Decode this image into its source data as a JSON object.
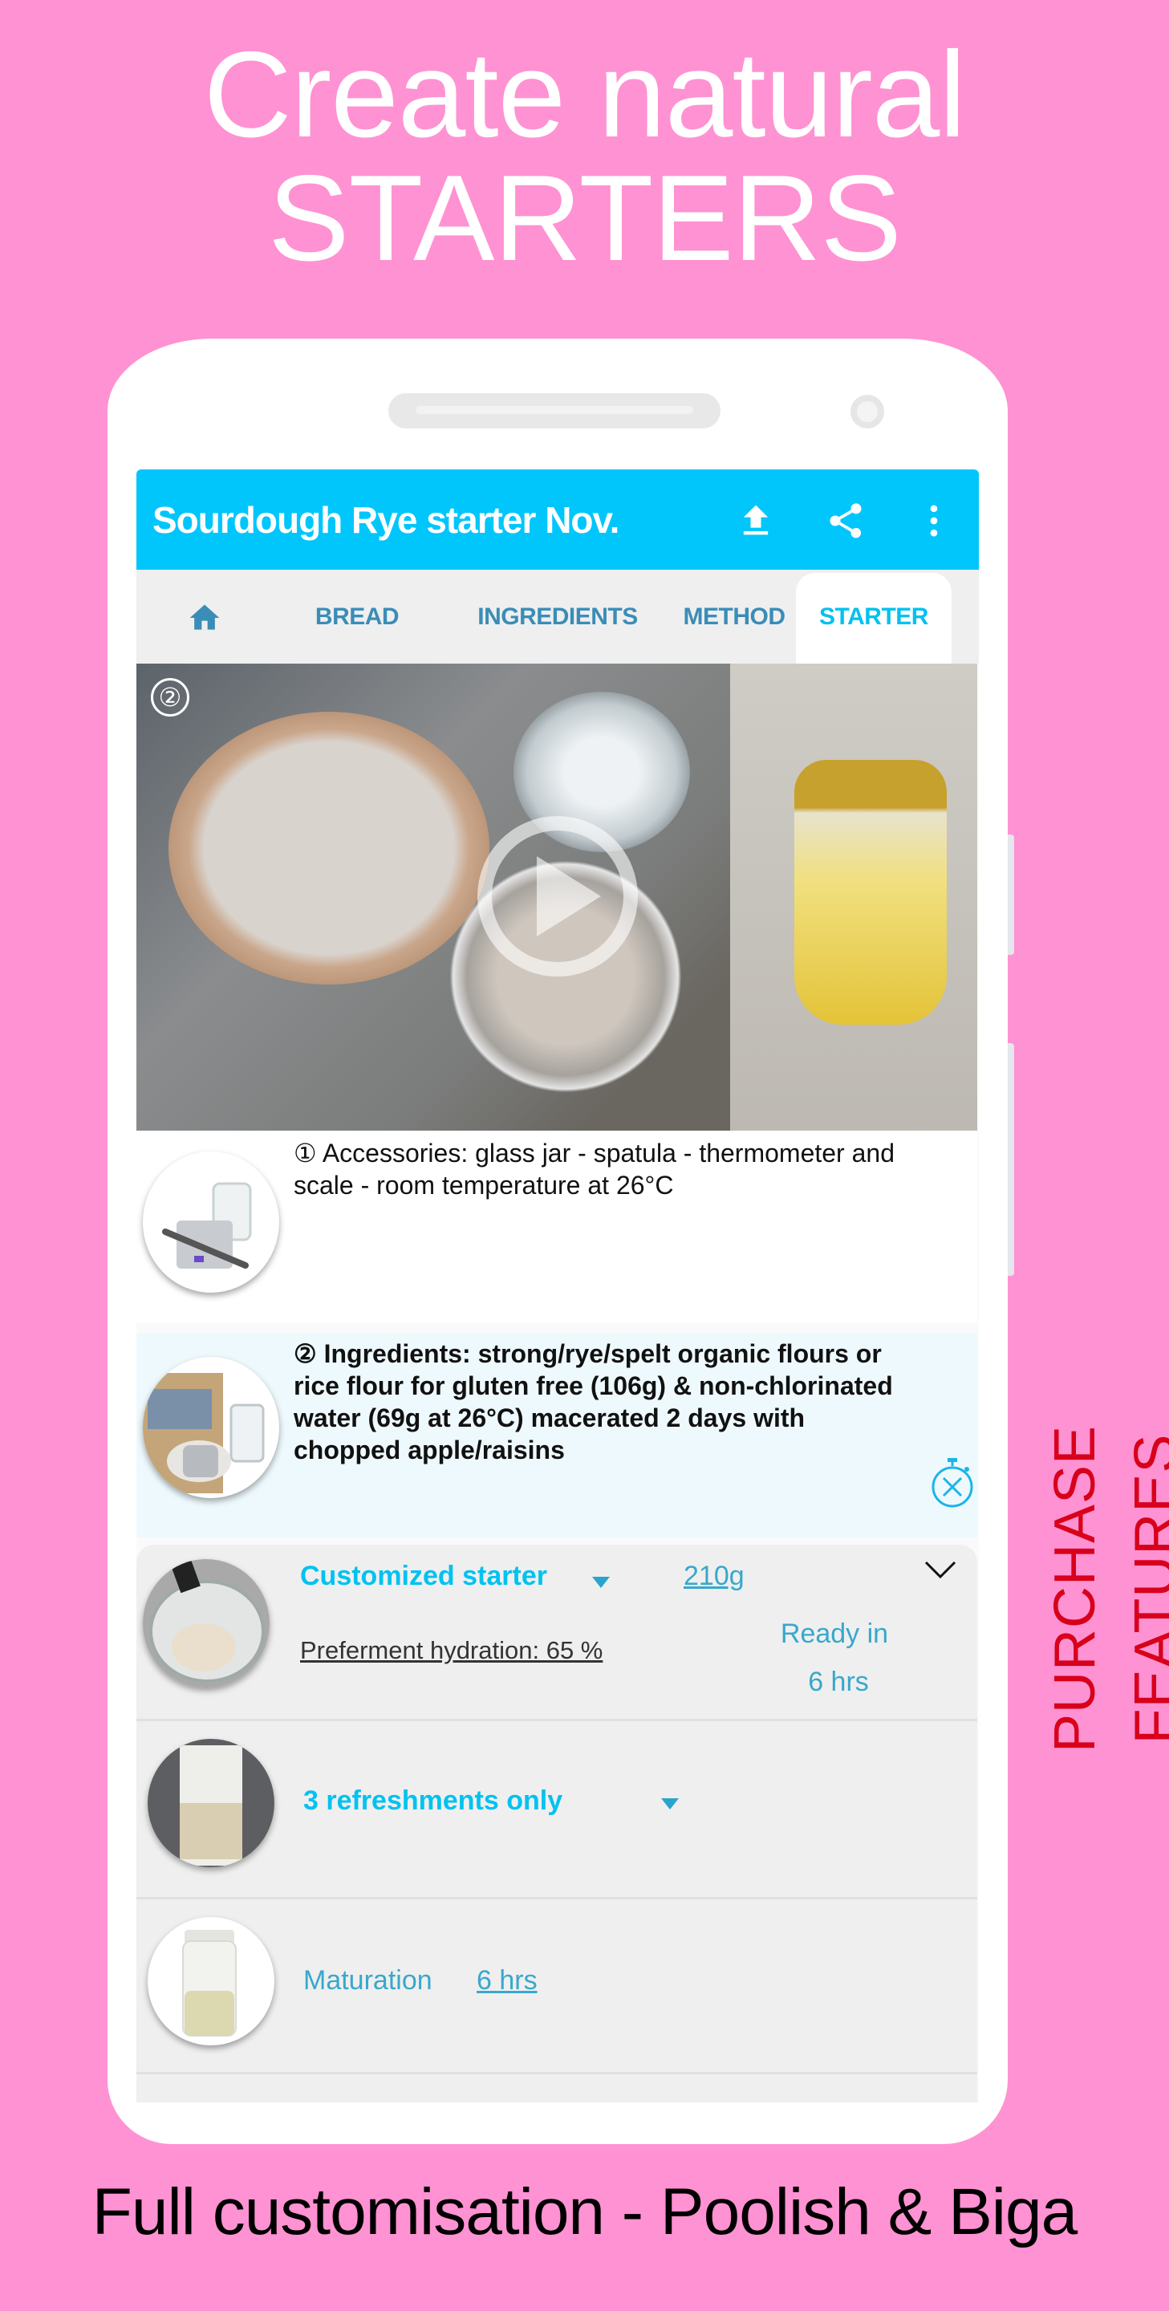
{
  "promo": {
    "headline_line1": "Create natural",
    "headline_line2": "STARTERS",
    "side_label": "PURCHASE FEATURES",
    "footer": "Full customisation - Poolish & Biga"
  },
  "app": {
    "title": "Sourdough Rye starter Nov.",
    "actions": [
      {
        "icon": "upload-icon"
      },
      {
        "icon": "share-icon"
      },
      {
        "icon": "more-vert-icon"
      }
    ],
    "tabs": [
      {
        "icon": "home-icon",
        "label": ""
      },
      {
        "label": "BREAD"
      },
      {
        "label": "INGREDIENTS"
      },
      {
        "label": "METHOD"
      },
      {
        "label": "STARTER",
        "active": true
      }
    ],
    "colors": {
      "appbar": "#00c6fb",
      "tab_text": "#3a8db7",
      "tab_active": "#00c1f0",
      "background_pink": "#ff92d2",
      "side_label_red": "#d8001a"
    }
  },
  "hero": {
    "step_badge": "②",
    "play_icon": "play-icon"
  },
  "steps": [
    {
      "text": "① Accessories: glass jar - spatula - thermometer and scale - room temperature at 26°C",
      "thumb": "accessories-image"
    },
    {
      "text": "② Ingredients: strong/rye/spelt organic flours or rice flour for gluten free (106g) & non-chlorinated water (69g at 26°C) macerated 2 days with chopped apple/raisins",
      "thumb": "ingredients-image",
      "timer_icon": "timer-off-icon"
    }
  ],
  "starter_card": {
    "type_label": "Customized starter",
    "weight": "210g",
    "hydration": "Preferment hydration: 65 %",
    "ready_label": "Ready in",
    "ready_value": "6 hrs",
    "refreshments_label": "3 refreshments only",
    "maturation_label": "Maturation",
    "maturation_value": "6 hrs"
  }
}
